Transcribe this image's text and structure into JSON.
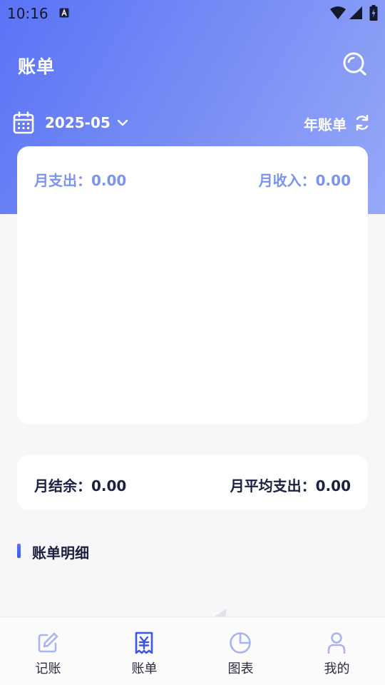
{
  "status_bar": {
    "time": "10:16"
  },
  "header": {
    "title": "账单",
    "search_icon": "search-icon",
    "month": "2025-05",
    "year_bill_label": "年账单"
  },
  "summary": {
    "monthly_expense": "月支出：0.00",
    "monthly_income": "月收入：0.00"
  },
  "balance": {
    "monthly_balance": "月结余：0.00",
    "monthly_avg_expense": "月平均支出：0.00"
  },
  "details": {
    "section_title": "账单明细"
  },
  "bottom_nav": {
    "items": [
      {
        "label": "记账",
        "icon": "edit-icon"
      },
      {
        "label": "账单",
        "icon": "bill-icon"
      },
      {
        "label": "图表",
        "icon": "pie-chart-icon"
      },
      {
        "label": "我的",
        "icon": "user-icon"
      }
    ],
    "active_color": "#3d56e8",
    "inactive_color": "#a9b4f0"
  },
  "colors": {
    "gradient_start": "#5a73f6",
    "gradient_end": "#96a8f7",
    "accent_text": "#7b93f2"
  }
}
